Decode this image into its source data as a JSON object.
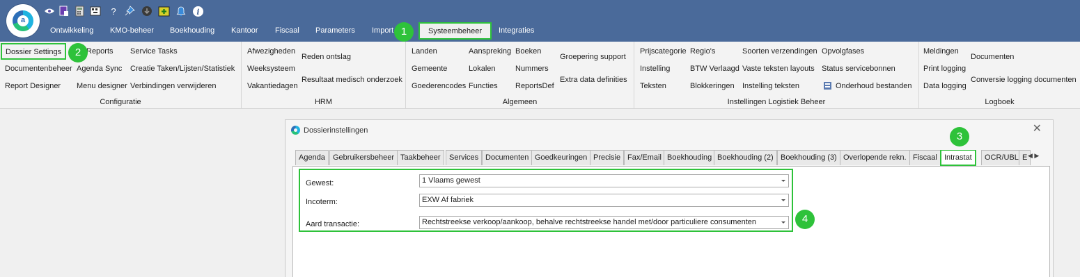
{
  "app": {
    "logo_letter": "a",
    "quick_icons": [
      "eye-icon",
      "document-icon",
      "calculator-icon",
      "keyboard-icon",
      "help-icon",
      "pin-icon",
      "download-icon",
      "add-icon",
      "bell-icon",
      "info-icon"
    ],
    "help_glyph": "?",
    "info_glyph": "i"
  },
  "menu": {
    "items": [
      "Ontwikkeling",
      "KMO-beheer",
      "Boekhouding",
      "Kantoor",
      "Fiscaal",
      "Parameters",
      "Import",
      "Systeembeheer",
      "Integraties"
    ],
    "active": "Systeembeheer"
  },
  "ribbon": {
    "configuratie": {
      "label": "Configuratie",
      "items": [
        "Dossier Settings",
        "Reports",
        "Service Tasks",
        "Documentenbeheer",
        "Agenda Sync",
        "Creatie Taken/Lijsten/Statistiek",
        "Report Designer",
        "Menu designer",
        "Verbindingen verwijderen"
      ]
    },
    "hrm": {
      "label": "HRM",
      "items": [
        "Afwezigheden",
        "Reden ontslag",
        "Weeksysteem",
        "Resultaat medisch onderzoek",
        "Vakantiedagen"
      ]
    },
    "algemeen": {
      "label": "Algemeen",
      "items": [
        "Landen",
        "Aanspreking",
        "Boeken",
        "Groepering support",
        "Gemeente",
        "Lokalen",
        "Nummers",
        "Goederencodes",
        "Functies",
        "ReportsDef",
        "Extra data definities"
      ]
    },
    "logistiek": {
      "label": "Instellingen Logistiek Beheer",
      "items": [
        "Prijscategorie",
        "Regio's",
        "Soorten verzendingen",
        "Opvolgfases",
        "Instelling",
        "BTW Verlaagd",
        "Vaste teksten layouts",
        "Status servicebonnen",
        "Teksten",
        "Blokkeringen",
        "Instelling teksten",
        "Onderhoud bestanden"
      ]
    },
    "logboek": {
      "label": "Logboek",
      "items": [
        "Meldingen",
        "Documenten",
        "Print logging",
        "Data logging",
        "Conversie logging documenten"
      ]
    }
  },
  "markers": [
    "1",
    "2",
    "3",
    "4"
  ],
  "dialog": {
    "title": "Dossierinstellingen",
    "close_glyph": "✕",
    "tabs": [
      "Agenda",
      "Gebruikersbeheer",
      "Taakbeheer",
      "Services",
      "Documenten",
      "Goedkeuringen",
      "Precisie",
      "Fax/Email",
      "Boekhouding",
      "Boekhouding (2)",
      "Boekhouding (3)",
      "Overlopende rekn.",
      "Fiscaal",
      "Intrastat",
      "OCR/UBL",
      "E"
    ],
    "active_tab": "Intrastat",
    "tab_nav": "◀ ▶",
    "fields": [
      {
        "label": "Gewest:",
        "value": "1 Vlaams gewest"
      },
      {
        "label": "Incoterm:",
        "value": "EXW Af fabriek"
      },
      {
        "label": "Aard transactie:",
        "value": "Rechtstreekse verkoop/aankoop, behalve rechtstreekse handel met/door particuliere consumenten"
      }
    ]
  },
  "colors": {
    "topbar": "#4a6a9a",
    "highlight": "#2ec23a",
    "ribbon_bg": "#f3f3f3"
  }
}
